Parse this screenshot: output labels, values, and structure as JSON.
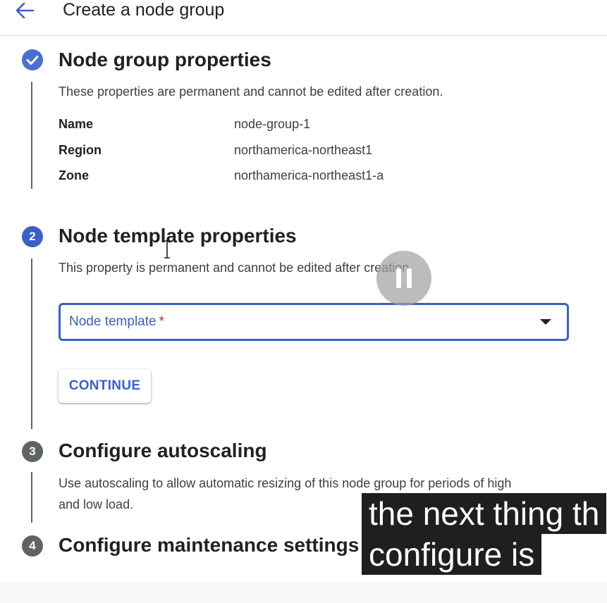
{
  "header": {
    "title": "Create a node group",
    "back_icon": "arrow-left-icon"
  },
  "steps": [
    {
      "marker": "check-icon",
      "title": "Node group properties",
      "description": "These properties are permanent and cannot be edited after creation.",
      "properties": [
        {
          "label": "Name",
          "value": "node-group-1"
        },
        {
          "label": "Region",
          "value": "northamerica-northeast1"
        },
        {
          "label": "Zone",
          "value": "northamerica-northeast1-a"
        }
      ]
    },
    {
      "number": "2",
      "title": "Node template properties",
      "description": "This property is permanent and cannot be edited after creation.",
      "select": {
        "label": "Node template",
        "required_mark": "*"
      },
      "continue_label": "CONTINUE"
    },
    {
      "number": "3",
      "title": "Configure autoscaling",
      "description_line1": "Use autoscaling to allow automatic resizing of this node group for periods of high",
      "description_line2": "and low load."
    },
    {
      "number": "4",
      "title": "Configure maintenance settings (optional)"
    }
  ],
  "video_overlay": {
    "pause_icon": "pause-icon",
    "caption_line1": "the next thing th",
    "caption_line2": "configure is"
  },
  "colors": {
    "accent": "#3b5fc9",
    "step_pending": "#5f6368",
    "required": "#c5221f"
  }
}
